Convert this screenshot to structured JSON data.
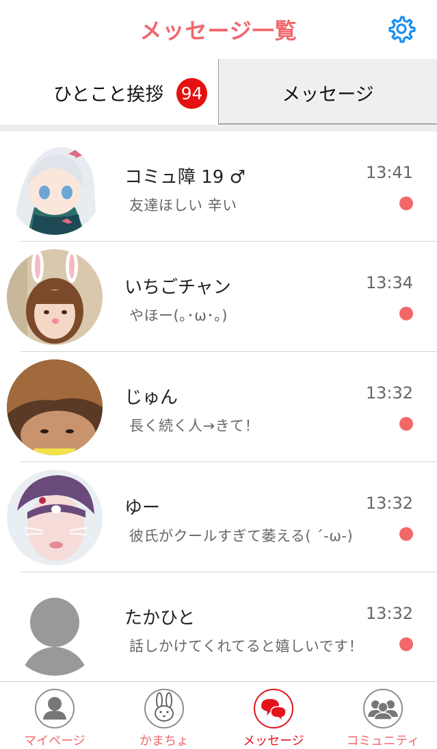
{
  "header": {
    "title": "メッセージ一覧",
    "settings_icon": "gear-icon"
  },
  "tabs": {
    "greeting": {
      "label": "ひとこと挨拶",
      "badge": "94"
    },
    "message": {
      "label": "メッセージ"
    }
  },
  "messages": [
    {
      "name": "コミュ障 19 ♂",
      "time": "13:41",
      "text": "友達ほしい 辛い",
      "unread": true
    },
    {
      "name": "いちごチャン",
      "time": "13:34",
      "text": "やほー(｡･ω･｡)",
      "unread": true
    },
    {
      "name": "じゅん",
      "time": "13:32",
      "text": "長く続く人→きて！",
      "unread": true
    },
    {
      "name": "ゆー",
      "time": "13:32",
      "text": "彼氏がクールすぎて萎える( ´-ω-)",
      "unread": true
    },
    {
      "name": "たかひと",
      "time": "13:32",
      "text": "話しかけてくれてると嬉しいです！",
      "unread": true
    }
  ],
  "tabbar": {
    "items": [
      {
        "label": "マイページ",
        "icon": "person-icon"
      },
      {
        "label": "かまちょ",
        "icon": "rabbit-icon"
      },
      {
        "label": "メッセージ",
        "icon": "chat-bubbles-icon",
        "active": true
      },
      {
        "label": "コミュニティ",
        "icon": "group-icon"
      }
    ]
  },
  "colors": {
    "accent": "#f0676c",
    "active": "#e3131b",
    "badge": "#e51010",
    "gear": "#1a8ef0",
    "unread_dot": "#f26868"
  }
}
